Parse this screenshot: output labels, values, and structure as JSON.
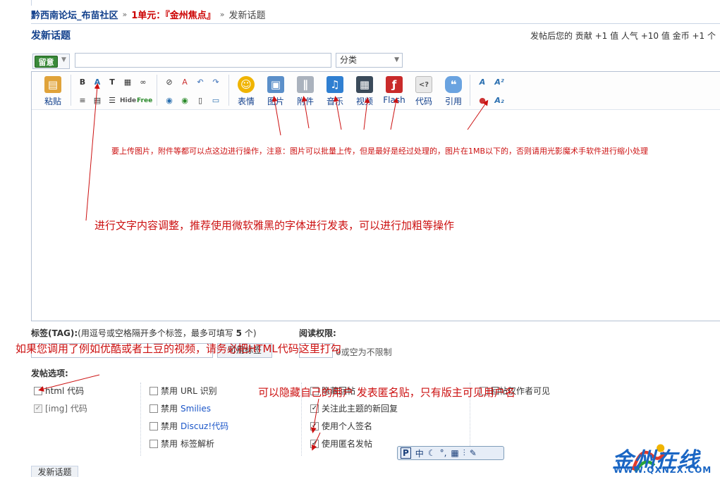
{
  "breadcrumb": {
    "forum": "黔西南论坛_布苗社区",
    "sep": "»",
    "unit": "1单元：『金州焦点』",
    "current": "发新话题"
  },
  "header": {
    "title": "发新话题",
    "reward": "发帖后您的 贡献 +1 值  人气 +10 值  金币 +1 个"
  },
  "subject": {
    "type_badge": "留意",
    "subject_value": "",
    "category": "分类"
  },
  "toolbar": {
    "paste": "粘贴",
    "emotion": "表情",
    "image": "图片",
    "attach": "附件",
    "music": "音乐",
    "video": "视频",
    "flash": "Flash",
    "code": "代码",
    "quote": "引用",
    "hide": "Hide",
    "free": "Free"
  },
  "annotations": {
    "upload": "要上传图片，附件等都可以点这边进行操作，注意：图片可以批量上传，但是最好是经过处理的，图片在1MB以下的，否则请用光影魔术手软件进行缩小处理",
    "font": "进行文字内容调整，推荐使用微软雅黑的字体进行发表，可以进行加粗等操作",
    "video": "如果您调用了例如优酷或者土豆的视频，请务必把HTML代码这里打勾",
    "anon": "可以隐藏自己的用户 发表匿名贴，只有版主可见用户名"
  },
  "tags": {
    "label_bold": "标签(TAG):",
    "label_hint": "(用逗号或空格隔开多个标签，最多可填写 ",
    "label_count": "5",
    "label_tail": " 个)",
    "button": "可用标签"
  },
  "permission": {
    "label": "阅读权限:",
    "hint": "0或空为不限制"
  },
  "options": {
    "label": "发帖选项:",
    "col1": [
      {
        "label": "html 代码",
        "checked": false,
        "disabled": false
      },
      {
        "label": "[img] 代码",
        "checked": true,
        "disabled": true
      }
    ],
    "col2": [
      {
        "prefix": "禁用",
        "label": "URL 识别",
        "link": false
      },
      {
        "prefix": "禁用",
        "label": "Smilies",
        "link": true
      },
      {
        "prefix": "禁用",
        "label": "Discuz!代码",
        "link": true
      },
      {
        "prefix": "禁用",
        "label": "标签解析",
        "link": false
      }
    ],
    "col3": [
      {
        "label": "隐藏回帖",
        "checked": false
      },
      {
        "label": "关注此主题的新回复",
        "checked": true
      },
      {
        "label": "使用个人签名",
        "checked": true
      },
      {
        "label": "使用匿名发帖",
        "checked": true
      }
    ],
    "col4": [
      {
        "label": "回帖仅作者可见",
        "checked": false
      }
    ]
  },
  "submit": "发新话题",
  "ime": {
    "p": "P",
    "zhong": "中"
  },
  "logo": {
    "name": "金州在线",
    "url": "WWW.QXNZX.COM"
  },
  "colors": {
    "annotation": "#cc1111",
    "link": "#12408c"
  }
}
